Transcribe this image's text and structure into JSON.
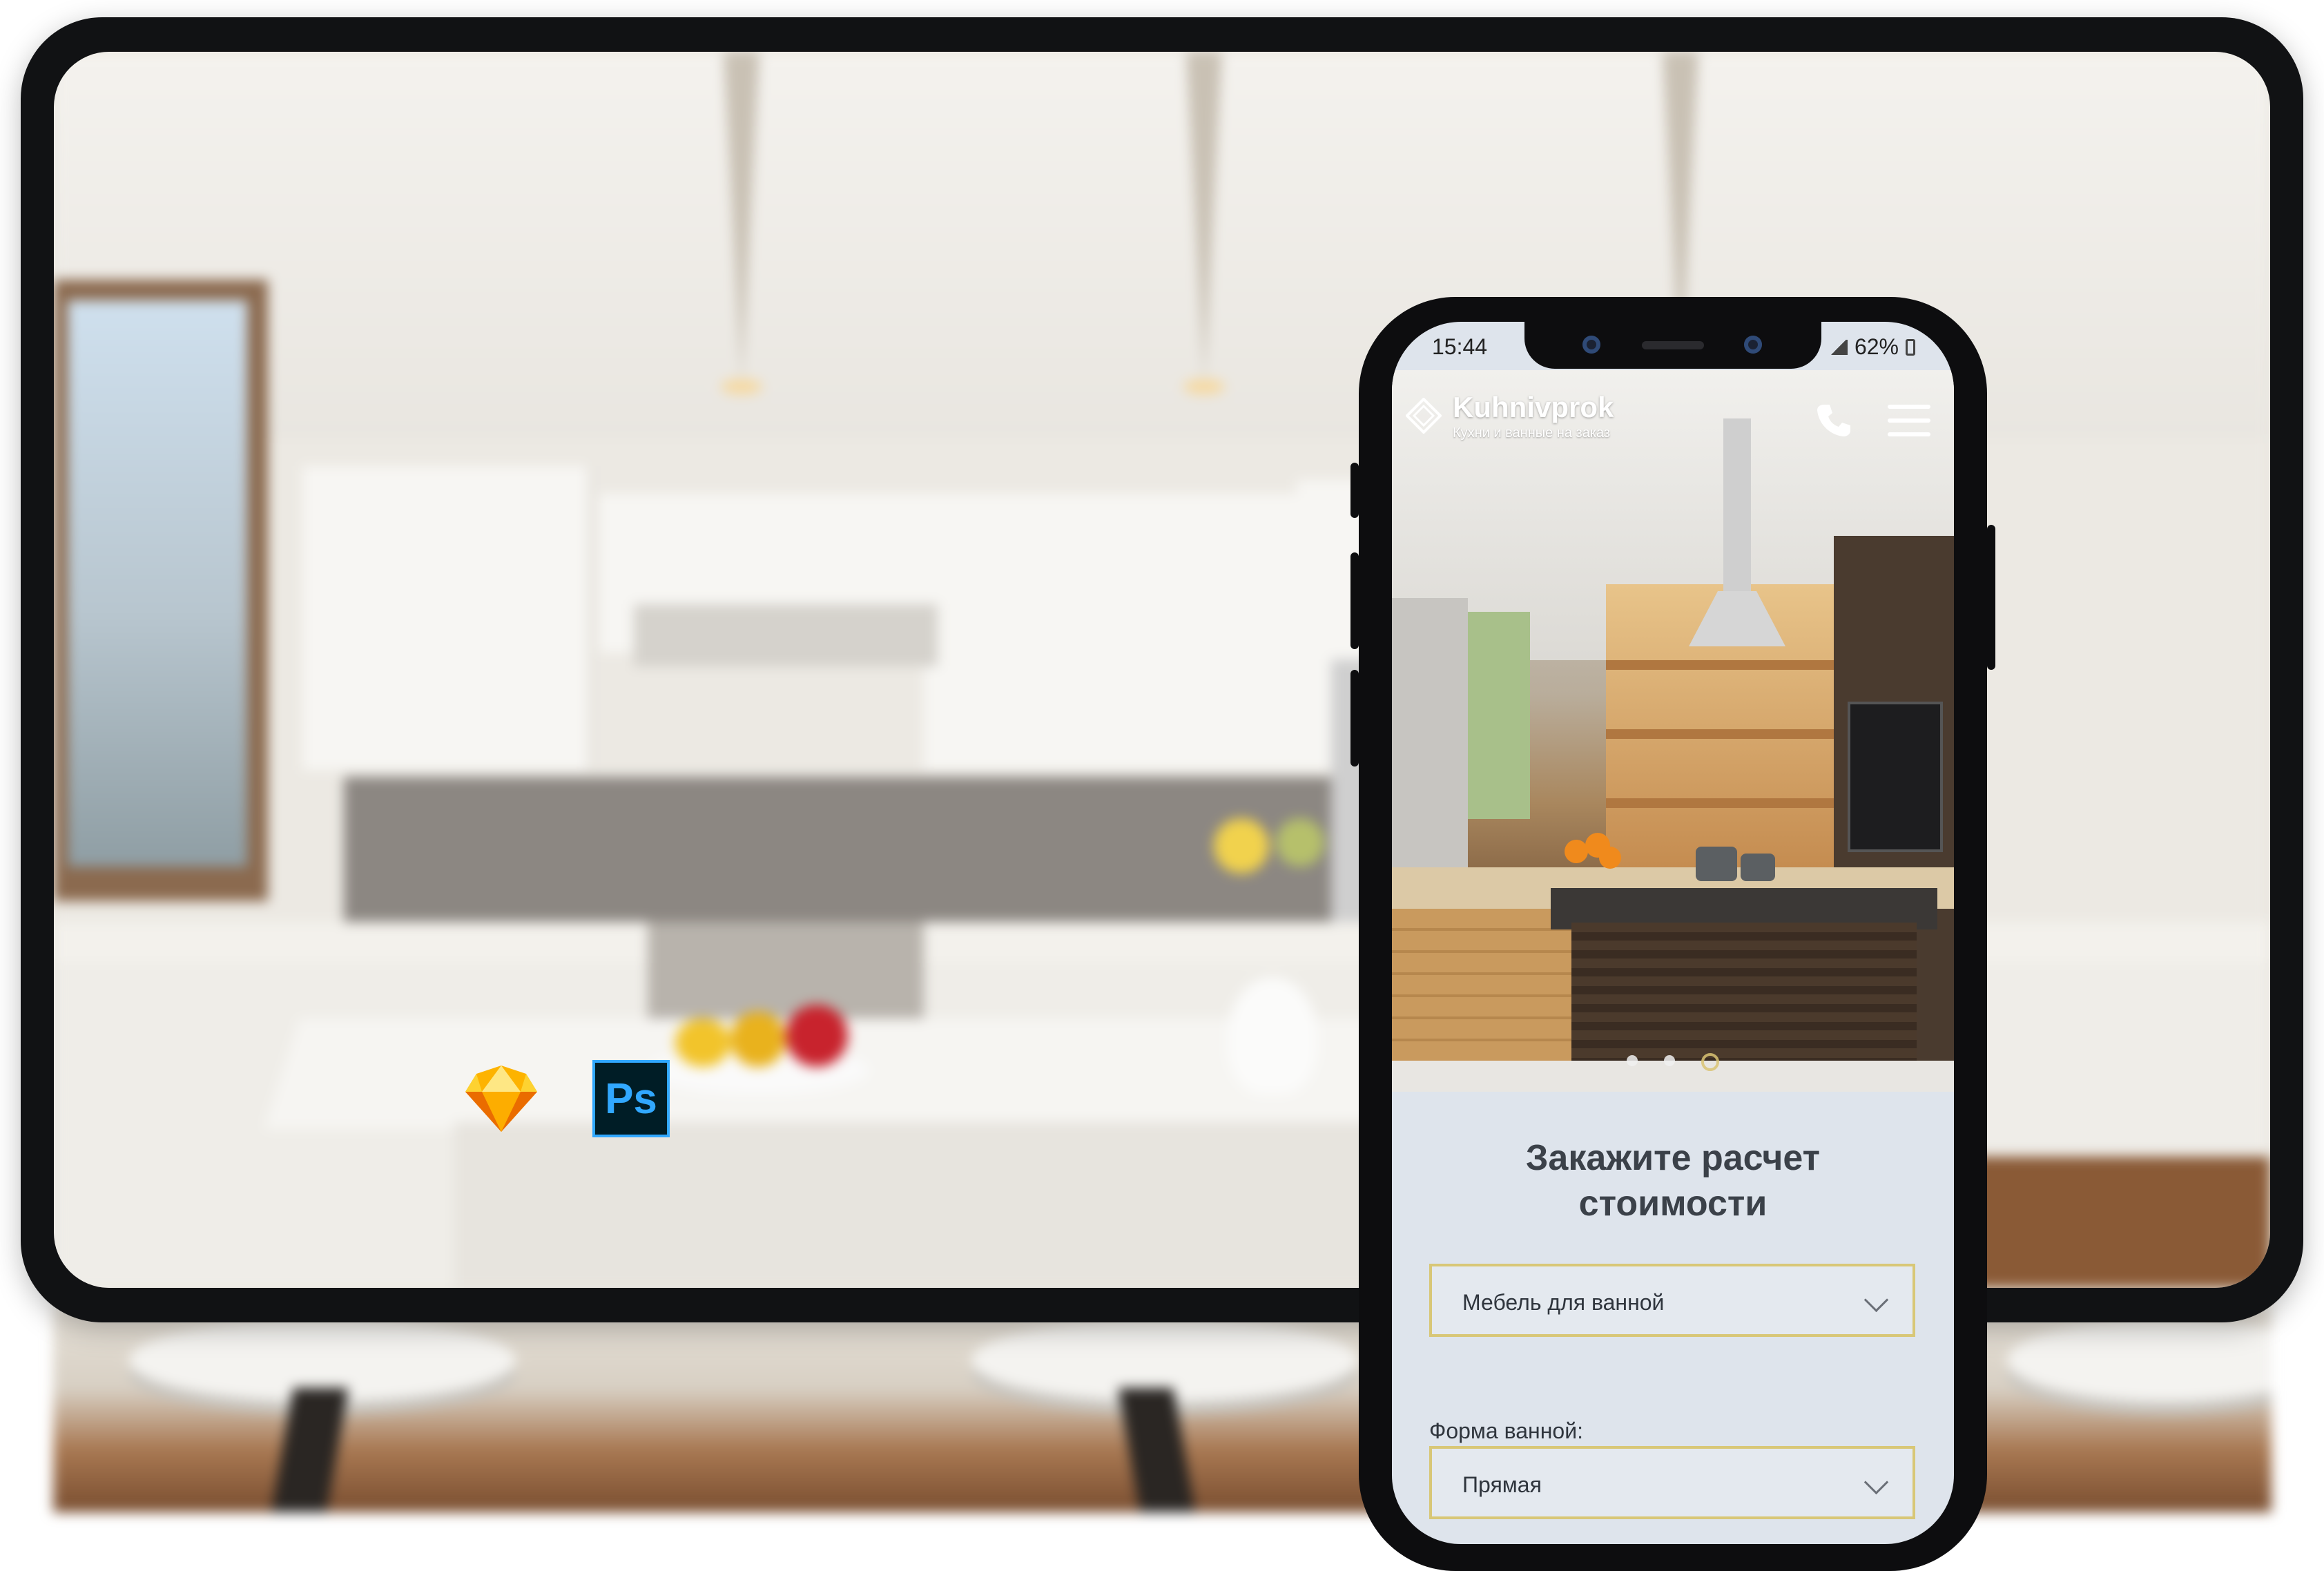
{
  "phone": {
    "status_time": "15:44",
    "battery": "62%"
  },
  "site": {
    "brand": "Kuhnivprok",
    "tagline": "Кухни и ванные на заказ",
    "slider_dots": 3,
    "active_slide": 3
  },
  "form": {
    "title_line1": "Закажите расчет",
    "title_line2": "стоимости",
    "category_value": "Мебель для ванной",
    "shape_label": "Форма ванной:",
    "shape_value": "Прямая"
  },
  "badges": {
    "ps_label": "Ps"
  },
  "colors": {
    "accent_gold": "#d8c777",
    "form_bg": "#dee4ec",
    "title_text": "#3b4149",
    "ps_blue": "#31a8ff",
    "ps_bg": "#001d26",
    "sketch_yellow": "#fdb300"
  },
  "icons": [
    "logo-diamond-icon",
    "phone-icon",
    "menu-icon",
    "chevron-down-icon",
    "sketch-icon",
    "photoshop-icon"
  ]
}
